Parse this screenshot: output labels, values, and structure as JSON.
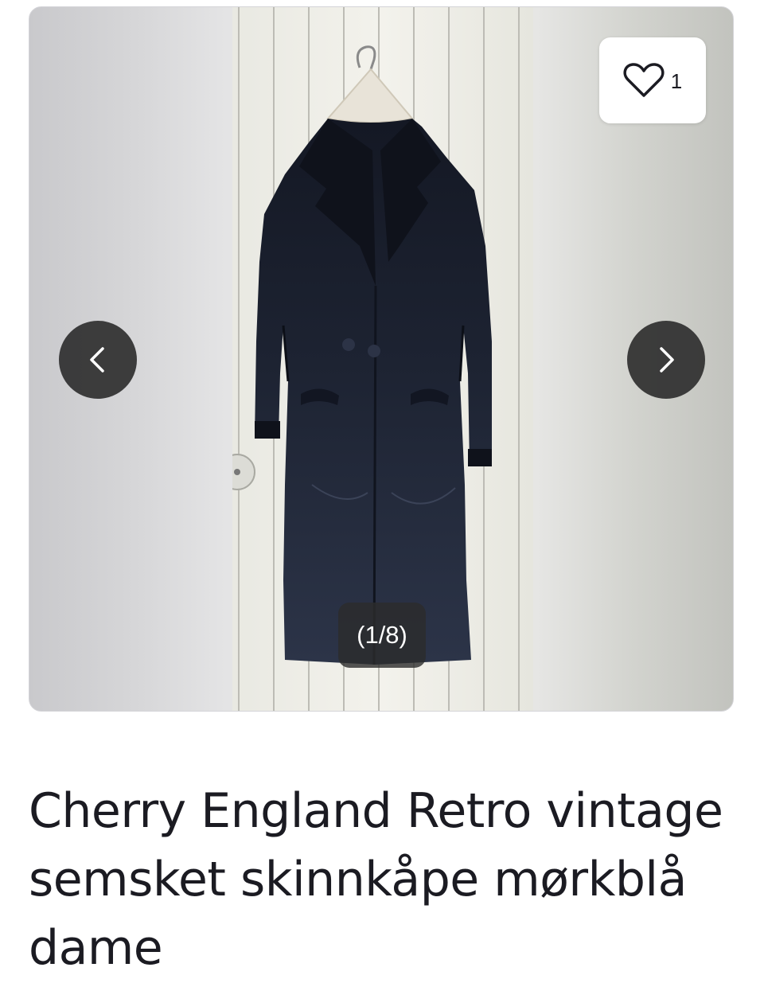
{
  "listing": {
    "title": "Cherry England Retro vintage semsket skinnkåpe mørkblå dame"
  },
  "gallery": {
    "counter": "(1/8)",
    "favorite_count": "1",
    "favorite_icon": "heart-outline-icon",
    "prev_icon": "chevron-left-icon",
    "next_icon": "chevron-right-icon"
  },
  "colors": {
    "text": "#1b1b22",
    "arrow_bg": "#2f2f2f",
    "coat": "#1f2535"
  }
}
